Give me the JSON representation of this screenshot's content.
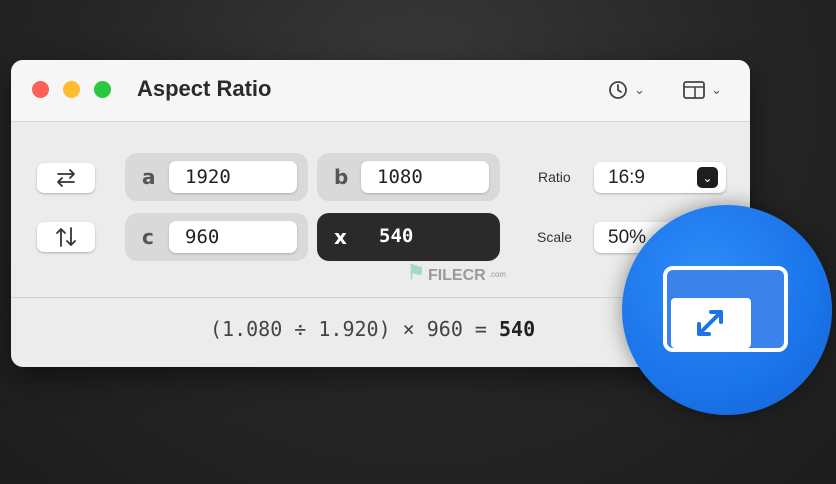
{
  "window": {
    "title": "Aspect Ratio",
    "toolbar": {
      "history_icon": "clock-icon",
      "layout_icon": "sidebar-layout-icon"
    }
  },
  "buttons": {
    "swap_horizontal_icon": "swap-horizontal-icon",
    "swap_vertical_icon": "swap-vertical-icon"
  },
  "fields": {
    "a": {
      "label": "a",
      "value": "1920"
    },
    "b": {
      "label": "b",
      "value": "1080"
    },
    "c": {
      "label": "c",
      "value": "960"
    },
    "x": {
      "label": "x",
      "value": "540"
    }
  },
  "ratio": {
    "label": "Ratio",
    "value": "16:9"
  },
  "scale": {
    "label": "Scale",
    "value": "50%"
  },
  "formula": {
    "expression": "(1.080 ÷ 1.920) × 960 = ",
    "result": "540"
  },
  "watermark": {
    "text": "FILECR",
    "domain": ".com"
  },
  "colors": {
    "accent": "#1a74ea",
    "close": "#fe5f57",
    "minimize": "#febc2e",
    "zoom": "#28c840"
  }
}
